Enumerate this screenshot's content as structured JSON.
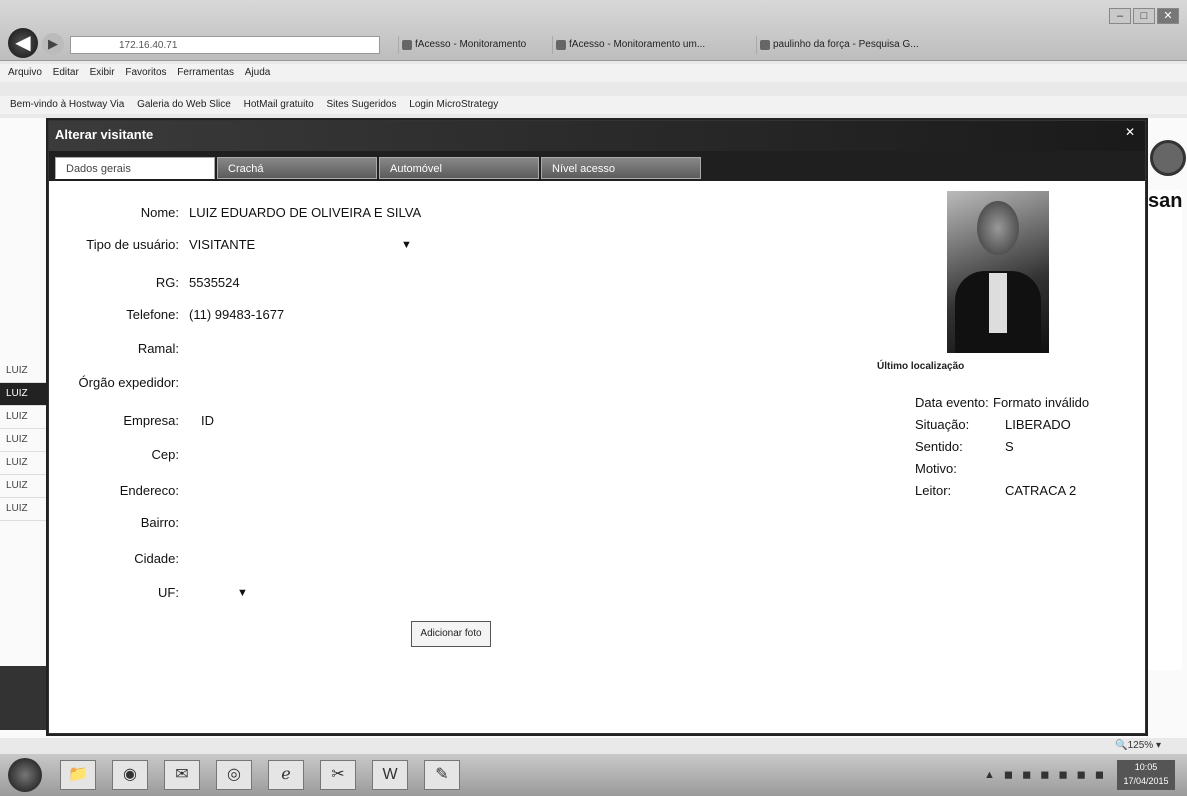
{
  "browser": {
    "address": "172.16.40.71",
    "tabs": [
      "fAcesso - Monitoramento",
      "fAcesso - Monitoramento um...",
      "paulinho da força - Pesquisa G..."
    ],
    "menu": [
      "Arquivo",
      "Editar",
      "Exibir",
      "Favoritos",
      "Ferramentas",
      "Ajuda"
    ],
    "favorites": [
      "Bem-vindo à Hostway Via",
      "Galeria do Web Slice",
      "HotMail gratuito",
      "Sites Sugeridos",
      "Login MicroStrategy"
    ]
  },
  "dialog": {
    "title": "Alterar visitante",
    "close": "✕",
    "tabs": [
      "Dados gerais",
      "Crachá",
      "Automóvel",
      "Nível acesso"
    ],
    "fields": {
      "nome": {
        "label": "Nome:",
        "value": "LUIZ EDUARDO DE OLIVEIRA E SILVA"
      },
      "tipo_usuario": {
        "label": "Tipo de usuário:",
        "value": "VISITANTE"
      },
      "rg": {
        "label": "RG:",
        "value": "5535524"
      },
      "telefone": {
        "label": "Telefone:",
        "value": "(11) 99483-1677"
      },
      "ramal": {
        "label": "Ramal:",
        "value": ""
      },
      "orgao_expedidor": {
        "label": "Órgão expedidor:",
        "value": ""
      },
      "empresa": {
        "label": "Empresa:",
        "value": "ID"
      },
      "cep": {
        "label": "Cep:",
        "value": ""
      },
      "endereco": {
        "label": "Endereco:",
        "value": ""
      },
      "bairro": {
        "label": "Bairro:",
        "value": ""
      },
      "cidade": {
        "label": "Cidade:",
        "value": ""
      },
      "uf": {
        "label": "UF:",
        "value": ""
      }
    },
    "add_photo_button": "Adicionar foto",
    "last_location": {
      "title": "Último localização",
      "data_evento": {
        "label": "Data evento:",
        "value": "Formato inválido"
      },
      "situacao": {
        "label": "Situação:",
        "value": "LIBERADO"
      },
      "sentido": {
        "label": "Sentido:",
        "value": "S"
      },
      "motivo": {
        "label": "Motivo:",
        "value": ""
      },
      "leitor": {
        "label": "Leitor:",
        "value": "CATRACA 2"
      }
    }
  },
  "background": {
    "brand": "san",
    "list_items": [
      "LUIZ",
      "LUIZ",
      "LUIZ",
      "LUIZ",
      "LUIZ",
      "LUIZ",
      "LUIZ"
    ]
  },
  "status": {
    "zoom": "125%"
  },
  "taskbar": {
    "clock_time": "10:05",
    "clock_date": "17/04/2015"
  },
  "colors": {
    "dialog_titlebar": "#1a1a1a",
    "accent": "#333333"
  }
}
